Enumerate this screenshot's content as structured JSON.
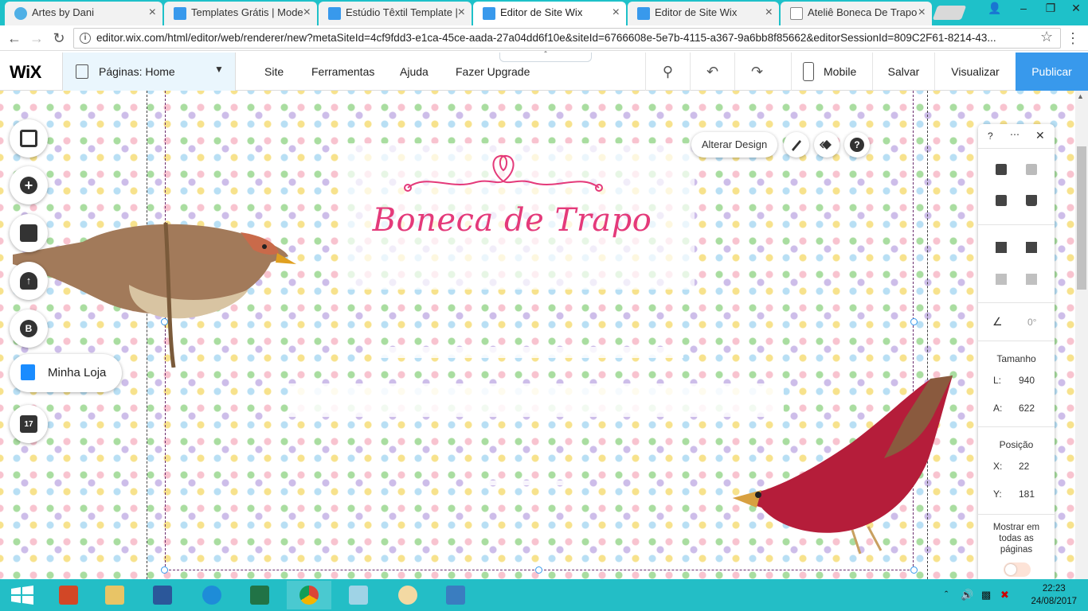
{
  "browser": {
    "tabs": [
      {
        "title": "Artes by Dani",
        "icon": "heart-icon",
        "color": "#4fb0e6"
      },
      {
        "title": "Templates Grátis | Mode",
        "icon": "wix-icon",
        "color": "#3899ec"
      },
      {
        "title": "Estúdio Têxtil Template |",
        "icon": "wix-icon",
        "color": "#3899ec"
      },
      {
        "title": "Editor de Site Wix",
        "icon": "wix-icon",
        "color": "#3899ec"
      },
      {
        "title": "Editor de Site Wix",
        "icon": "wix-icon",
        "color": "#3899ec"
      },
      {
        "title": "Ateliê Boneca De Trapo",
        "icon": "page-icon",
        "color": "#888888"
      }
    ],
    "active_tab": 3,
    "url": "editor.wix.com/html/editor/web/renderer/new?metaSiteId=4cf9fdd3-e1ca-45ce-aada-27a04dd6f10e&siteId=6766608e-5e7b-4115-a367-9a6bb8f85662&editorSessionId=809C2F61-8214-43..."
  },
  "editor": {
    "logo": "WiX",
    "pages_label": "Páginas: Home",
    "menu": [
      "Site",
      "Ferramentas",
      "Ajuda",
      "Fazer Upgrade"
    ],
    "mobile_label": "Mobile",
    "save_label": "Salvar",
    "preview_label": "Visualizar",
    "publish_label": "Publicar",
    "accent_color": "#3899ec"
  },
  "canvas": {
    "site_title": "Boneca de Trapo",
    "title_color": "#e43a7a",
    "change_design_label": "Alterar Design",
    "shop_label": "Minha Loja",
    "side_icons": [
      "background-icon",
      "add-icon",
      "app-market-icon",
      "upload-icon",
      "blog-icon",
      "bookings-icon"
    ]
  },
  "inspector": {
    "help": "?",
    "size_title": "Tamanho",
    "width_label": "L:",
    "width_value": "940",
    "height_label": "A:",
    "height_value": "622",
    "position_title": "Posição",
    "x_label": "X:",
    "x_value": "22",
    "y_label": "Y:",
    "y_value": "181",
    "rotation_value": "0°",
    "show_all_pages": "Mostrar em todas as páginas"
  },
  "taskbar": {
    "apps": [
      "windows-start-icon",
      "powerpoint-icon",
      "file-explorer-icon",
      "word-icon",
      "internet-explorer-icon",
      "excel-icon",
      "chrome-icon",
      "notepad-icon",
      "paint-icon",
      "photos-icon"
    ],
    "active_app": 6,
    "time": "22:23",
    "date": "24/08/2017"
  }
}
